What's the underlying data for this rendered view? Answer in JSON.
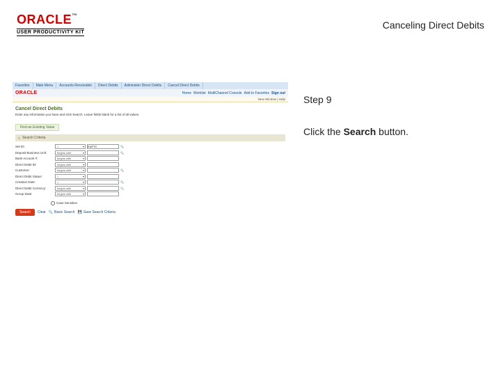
{
  "header": {
    "oracle": "ORACLE",
    "tm": "™",
    "upk": "USER PRODUCTIVITY KIT",
    "title": "Canceling Direct Debits"
  },
  "guide": {
    "step_label": "Step 9",
    "instruction_pre": "Click the ",
    "instruction_bold": "Search",
    "instruction_post": " button."
  },
  "app": {
    "tabs": [
      "Favorites",
      "Main Menu",
      "Accounts Receivable",
      "Direct Debits",
      "Administer Direct Debits",
      "Cancel Direct Debits"
    ],
    "logo": "ORACLE",
    "toolbar_links": [
      "Home",
      "Worklist",
      "MultiChannel Console",
      "Add to Favorites"
    ],
    "toolbar_signout": "Sign out",
    "underbar": "New Window | Help",
    "page_heading": "Cancel Direct Debits",
    "page_instruction": "Enter any information you have and click Search. Leave fields blank for a list of all values.",
    "subtab": "Find an Existing Value",
    "panel_head": "Search Criteria",
    "fields": [
      {
        "label": "Set ID:",
        "op": "=",
        "val": "EUFTC",
        "mag": true
      },
      {
        "label": "Deposit Business Unit:",
        "op": "begins with",
        "val": "",
        "mag": true
      },
      {
        "label": "Bank Account #:",
        "op": "begins with",
        "val": "",
        "mag": false
      },
      {
        "label": "Direct Debit ID:",
        "op": "begins with",
        "val": "",
        "mag": false
      },
      {
        "label": "Customer:",
        "op": "begins with",
        "val": "",
        "mag": true
      },
      {
        "label": "Direct Debit Status:",
        "op": "=",
        "val": "",
        "mag": false
      },
      {
        "label": "Creation Date:",
        "op": "=",
        "val": "",
        "mag": true
      },
      {
        "label": "Direct Debit Currency:",
        "op": "begins with",
        "val": "",
        "mag": true
      },
      {
        "label": "Group Date:",
        "op": "begins with",
        "val": "",
        "mag": false
      }
    ],
    "checkbox": "Case Sensitive",
    "buttons": {
      "search": "Search",
      "clear": "Clear",
      "basic": "Basic Search",
      "save": "Save Search Criteria"
    }
  }
}
